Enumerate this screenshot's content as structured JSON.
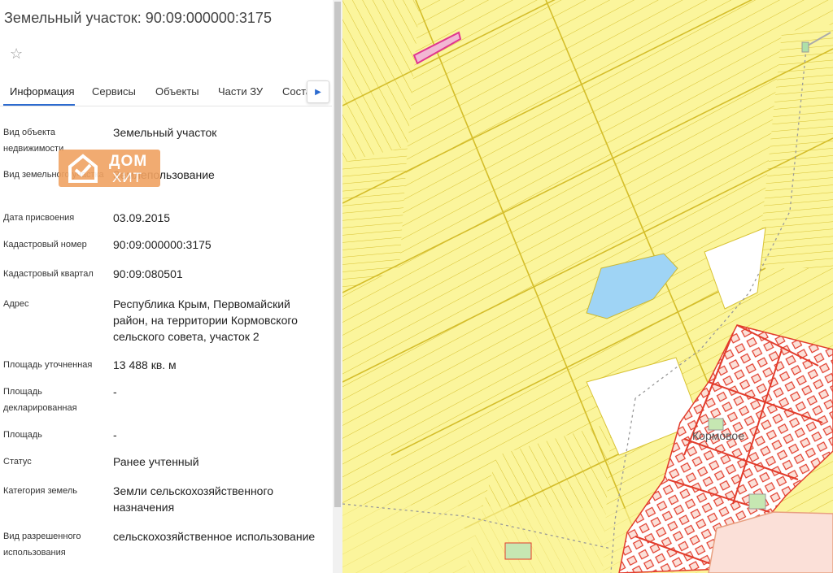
{
  "panel": {
    "title": "Земельный участок: 90:09:000000:3175",
    "tabs": [
      "Информация",
      "Сервисы",
      "Объекты",
      "Части ЗУ",
      "Соста"
    ],
    "rows": [
      {
        "label": "Вид объекта недвижимости",
        "value": "Земельный участок"
      },
      {
        "label": "Вид земельного участка",
        "value": "Землепользование"
      },
      {
        "label": "Дата присвоения",
        "value": "03.09.2015"
      },
      {
        "label": "Кадастровый номер",
        "value": "90:09:000000:3175"
      },
      {
        "label": "Кадастровый квартал",
        "value": "90:09:080501"
      },
      {
        "label": "Адрес",
        "value": "Республика Крым, Первомайский район, на территории Кормовского сельского совета, участок 2"
      },
      {
        "label": "Площадь уточненная",
        "value": "13 488 кв. м"
      },
      {
        "label": "Площадь декларированная",
        "value": "-"
      },
      {
        "label": "Площадь",
        "value": "-"
      },
      {
        "label": "Статус",
        "value": "Ранее учтенный"
      },
      {
        "label": "Категория земель",
        "value": "Земли сельскохозяйственного назначения"
      },
      {
        "label": "Вид разрешенного использования",
        "value": "сельскохозяйственное использование"
      }
    ]
  },
  "watermark": {
    "line1": "ДОМ",
    "line2": "ХИТ"
  },
  "map": {
    "village_label": "Кормовое"
  },
  "colors": {
    "accent": "#2d6bcf",
    "field": "#fbf59c",
    "parcel_line": "#d8c233",
    "settlement": "#e23c2c",
    "water": "#9fd4f5",
    "selected": "#e0358f"
  }
}
